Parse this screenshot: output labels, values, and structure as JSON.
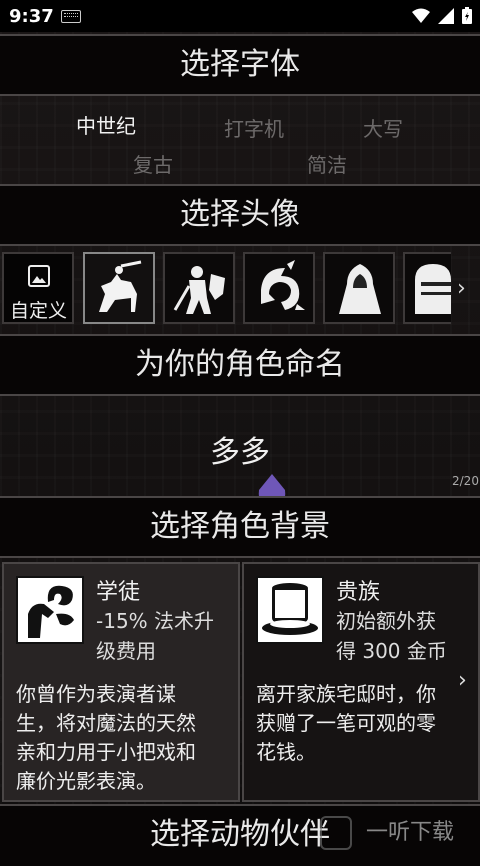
{
  "status_bar": {
    "time": "9:37"
  },
  "font_section": {
    "header": "选择字体",
    "options": [
      {
        "label": "中世纪"
      },
      {
        "label": "打字机"
      },
      {
        "label": "大写"
      },
      {
        "label": "复古"
      },
      {
        "label": "简洁"
      }
    ]
  },
  "avatar_section": {
    "header": "选择头像",
    "custom_label": "自定义",
    "avatars": [
      "knight-on-horse",
      "warrior-with-shield",
      "beast-claw",
      "hooded-figure",
      "helmet"
    ]
  },
  "name_section": {
    "header": "为你的角色命名",
    "character_name": "多多",
    "page_counter": "2/20"
  },
  "background_section": {
    "header": "选择角色背景",
    "cards": [
      {
        "title": "学徒",
        "subtitle_line1": "-15% 法术升",
        "subtitle_line2": "级费用",
        "desc_line1": "你曾作为表演者谋",
        "desc_line2": "生，将对魔法的天然",
        "desc_line3": "亲和力用于小把戏和",
        "desc_line4": "廉价光影表演。"
      },
      {
        "title": "贵族",
        "subtitle_line1": "初始额外获",
        "subtitle_line2": "得 300 金币",
        "desc_line1": "离开家族宅邸时，你",
        "desc_line2": "获赠了一笔可观的零",
        "desc_line3": "花钱。"
      }
    ]
  },
  "companion_section": {
    "header": "选择动物伙伴"
  },
  "watermark": {
    "text": "一听下载"
  }
}
